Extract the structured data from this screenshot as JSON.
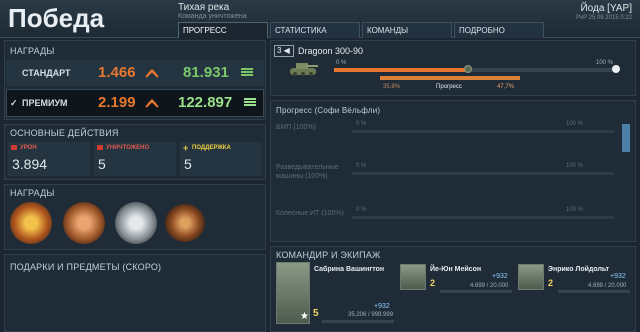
{
  "header": {
    "title": "Победа",
    "map_name": "Тихая река",
    "result_note": "Команда уничтожена",
    "player": "Йода [YAP]",
    "date": "PvP 25.09.2015 0:22"
  },
  "tabs": [
    {
      "label": "ПРОГРЕСС",
      "active": true
    },
    {
      "label": "СТАТИСТИКА",
      "active": false
    },
    {
      "label": "КОМАНДЫ",
      "active": false
    },
    {
      "label": "ПОДРОБНО",
      "active": false
    }
  ],
  "rewards": {
    "heading": "НАГРАДЫ",
    "standard": {
      "label": "СТАНДАРТ",
      "xp": "1.466",
      "credits": "81.931"
    },
    "premium": {
      "check": "✓",
      "label": "ПРЕМИУМ",
      "xp": "2.199",
      "credits": "122.897"
    }
  },
  "actions": {
    "heading": "ОСНОВНЫЕ ДЕЙСТВИЯ",
    "items": [
      {
        "label": "УРОН",
        "value": "3.894",
        "color": "#d23b32"
      },
      {
        "label": "УНИЧТОЖЕНО",
        "value": "5",
        "color": "#d23b32"
      },
      {
        "label": "ПОДДЕРЖКА",
        "value": "5",
        "color": "#f0d040",
        "prefix": "+"
      }
    ]
  },
  "medals": {
    "heading": "НАГРАДЫ",
    "items": [
      "medal-gold-icon",
      "medal-bronze-eagle-icon",
      "medal-silver-star-icon",
      "medal-bronze-wings-icon"
    ]
  },
  "gifts": {
    "heading": "ПОДАРКИ И ПРЕДМЕТЫ (СКОРО)"
  },
  "vehicle": {
    "tier": "3",
    "name": "Dragoon 300-90",
    "left_pct": "0 %",
    "right_pct": "100 %",
    "prev_pct": "35,8%",
    "progress_label": "Прогресс",
    "new_pct": "47,7%",
    "prev_value": 0.358,
    "new_value": 0.477
  },
  "research": {
    "heading": "Прогресс (Софи Вёльфли)",
    "rows": [
      {
        "label": "БМП (100%)",
        "start": "0 %",
        "end": "100 %"
      },
      {
        "label": "Разведывательные машины (100%)",
        "start": "0 %",
        "end": "100 %"
      },
      {
        "label": "Колесные ИТ (100%)",
        "start": "0 %",
        "end": "100 %"
      }
    ]
  },
  "crew": {
    "heading": "КОМАНДИР И ЭКИПАЖ",
    "commander": {
      "name": "Сабрина Вашингтон",
      "level": "5",
      "xp_gain": "+932",
      "progress": "35.206 / 999.999"
    },
    "members": [
      {
        "name": "Йе-Юн Мейсон",
        "level": "2",
        "xp_gain": "+932",
        "progress": "4.699 / 20.000"
      },
      {
        "name": "Энрико Лойдольт",
        "level": "2",
        "xp_gain": "+932",
        "progress": "4.699 / 20.000"
      }
    ]
  }
}
